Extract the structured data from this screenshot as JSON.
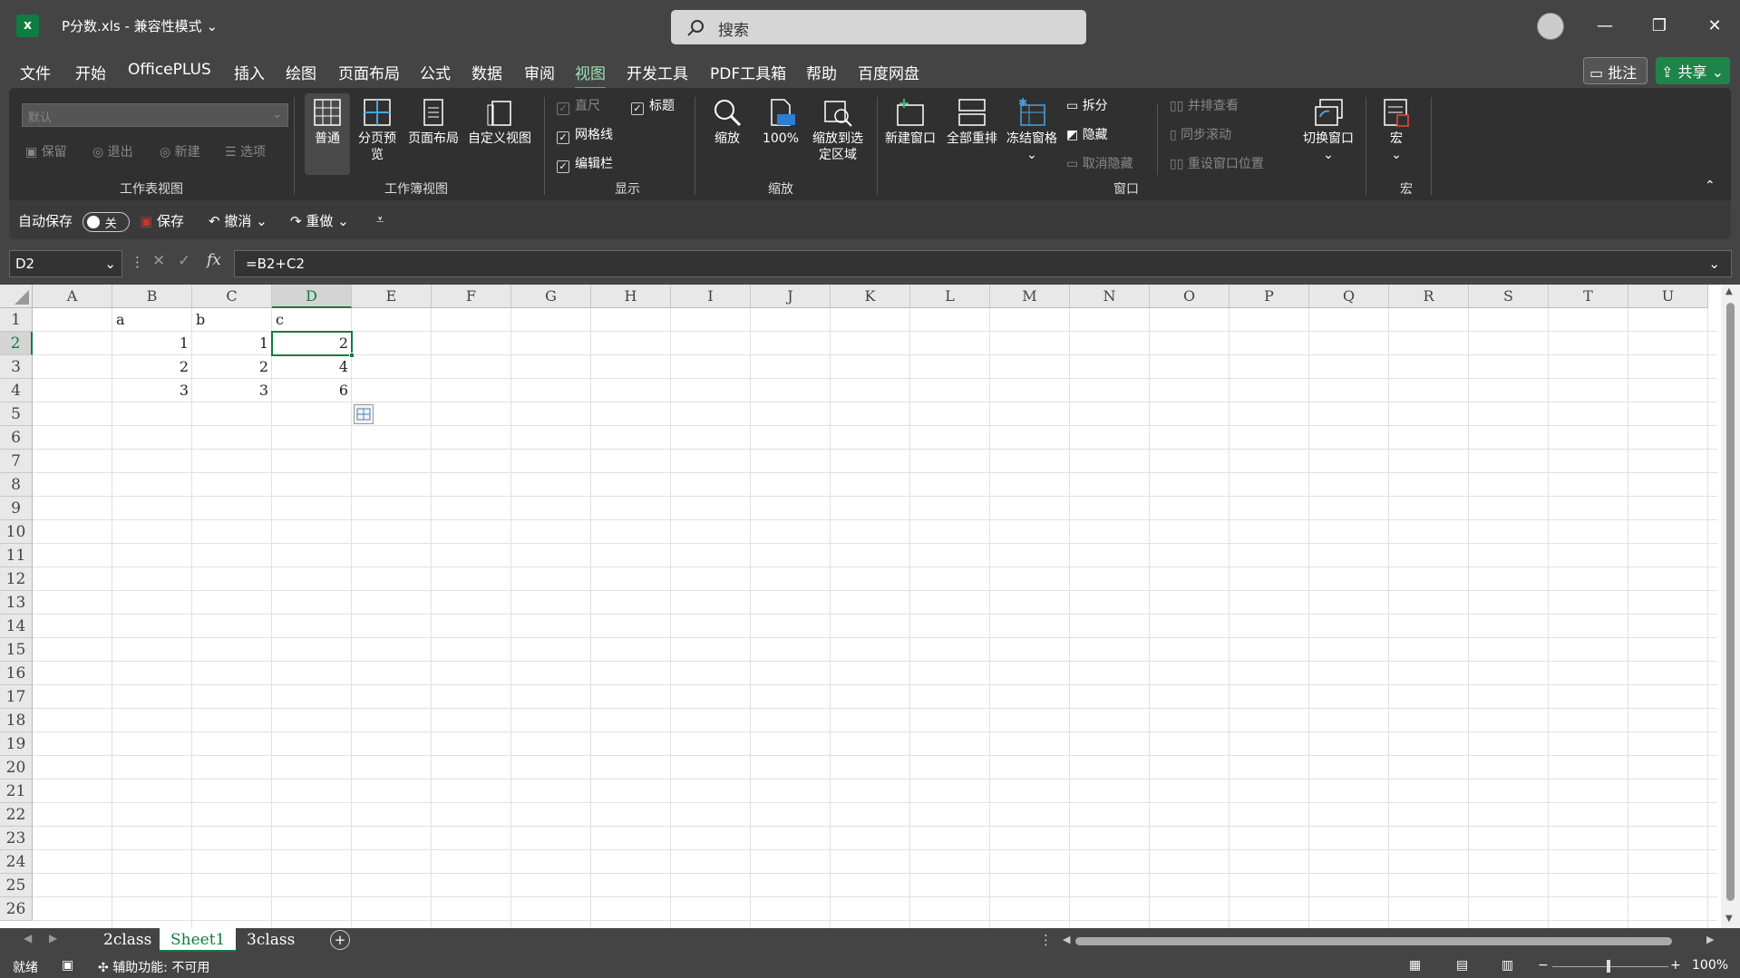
{
  "window": {
    "title": "P分数.xls",
    "mode": "兼容性模式",
    "app_icon": "excel-icon"
  },
  "search": {
    "placeholder": "搜索"
  },
  "window_controls": {
    "minimize": "—",
    "restore": "❐",
    "close": "✕"
  },
  "menu": {
    "tabs": [
      "文件",
      "开始",
      "OfficePLUS",
      "插入",
      "绘图",
      "页面布局",
      "公式",
      "数据",
      "审阅",
      "视图",
      "开发工具",
      "PDF工具箱",
      "帮助",
      "百度网盘"
    ],
    "active": "视图"
  },
  "header_buttons": {
    "comment": "批注",
    "share": "共享"
  },
  "ribbon": {
    "sheet_view": {
      "dropdown_value": "默认",
      "keep": "保留",
      "exit": "退出",
      "new": "新建",
      "options": "选项",
      "label": "工作表视图"
    },
    "workbook_view": {
      "normal": "普通",
      "page_break": "分页预览",
      "page_layout": "页面布局",
      "custom": "自定义视图",
      "label": "工作簿视图"
    },
    "show": {
      "ruler": "直尺",
      "gridlines": "网格线",
      "formula_bar": "编辑栏",
      "headings": "标题",
      "label": "显示"
    },
    "zoom": {
      "zoom": "缩放",
      "hundred": "100%",
      "zoom_selection": "缩放到选定区域",
      "label": "缩放"
    },
    "window": {
      "new_window": "新建窗口",
      "arrange_all": "全部重排",
      "freeze": "冻结窗格",
      "split": "拆分",
      "hide": "隐藏",
      "unhide": "取消隐藏",
      "side_by_side": "并排查看",
      "sync_scroll": "同步滚动",
      "reset_pos": "重设窗口位置",
      "switch": "切换窗口",
      "label": "窗口"
    },
    "macro": {
      "macro": "宏",
      "label": "宏"
    }
  },
  "qat": {
    "autosave": "自动保存",
    "toggle_state": "关",
    "save": "保存",
    "undo": "撤消",
    "redo": "重做"
  },
  "formula_bar": {
    "name_box": "D2",
    "formula": "=B2+C2"
  },
  "sheet": {
    "columns": [
      "A",
      "B",
      "C",
      "D",
      "E",
      "F",
      "G",
      "H",
      "I",
      "J",
      "K",
      "L",
      "M",
      "N",
      "O",
      "P",
      "Q",
      "R",
      "S",
      "T",
      "U"
    ],
    "rows": [
      "1",
      "2",
      "3",
      "4",
      "5",
      "6",
      "7",
      "8",
      "9",
      "10",
      "11",
      "12",
      "13",
      "14",
      "15",
      "16",
      "17",
      "18",
      "19",
      "20",
      "21",
      "22",
      "23",
      "24",
      "25",
      "26"
    ],
    "selected_column": "D",
    "selected_row": "2",
    "cells": {
      "B1": "a",
      "C1": "b",
      "D1": "c",
      "B2": "1",
      "C2": "1",
      "D2": "2",
      "B3": "2",
      "C3": "2",
      "D3": "4",
      "B4": "3",
      "C4": "3",
      "D4": "6"
    }
  },
  "sheet_tabs": {
    "tabs": [
      "2class",
      "Sheet1",
      "3class"
    ],
    "active": "Sheet1"
  },
  "status": {
    "ready": "就绪",
    "accessibility": "辅助功能: 不可用",
    "zoom": "100%"
  }
}
